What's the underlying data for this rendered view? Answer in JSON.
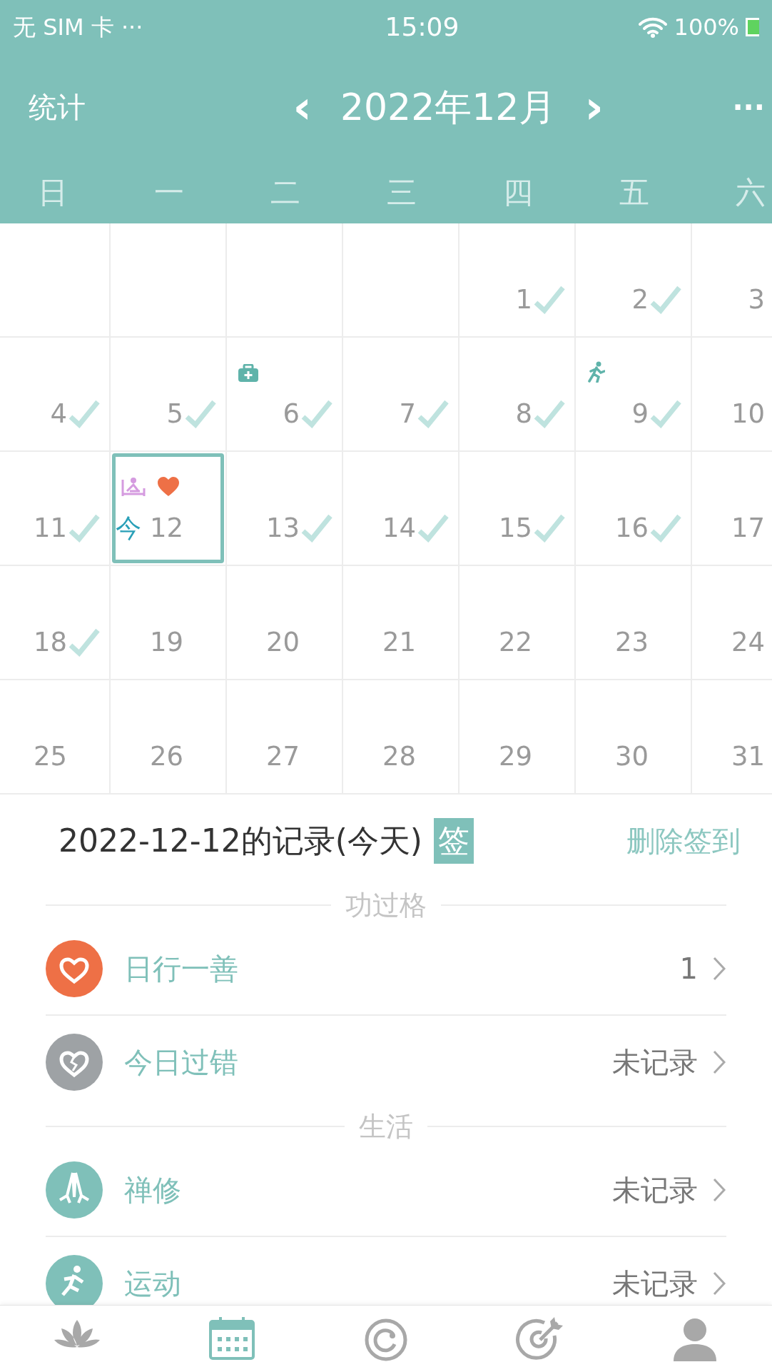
{
  "status_bar": {
    "carrier": "无 SIM 卡 ···",
    "time": "15:09",
    "battery": "100%"
  },
  "header": {
    "left": "统计",
    "prev": "‹",
    "title": "2022年12月",
    "next": "›",
    "more": "···"
  },
  "weekdays": [
    "日",
    "一",
    "二",
    "三",
    "四",
    "五",
    "六"
  ],
  "weeks": [
    [
      {
        "day": "1",
        "checked": true
      },
      {
        "day": "2",
        "checked": true
      },
      {
        "day": "3",
        "checked": false
      }
    ],
    [
      {
        "day": "4",
        "checked": true
      },
      {
        "day": "5",
        "checked": true
      },
      {
        "day": "6",
        "checked": true,
        "marks": [
          {
            "kind": "medical"
          }
        ]
      },
      {
        "day": "7",
        "checked": true
      },
      {
        "day": "8",
        "checked": true
      },
      {
        "day": "9",
        "checked": true,
        "marks": [
          {
            "kind": "exercise"
          }
        ]
      },
      {
        "day": "10",
        "checked": false
      }
    ],
    [
      {
        "day": "11",
        "checked": true
      },
      {
        "day": "12",
        "checked": false,
        "selected": true,
        "today_label": "今",
        "marks": [
          {
            "kind": "meditation"
          },
          {
            "kind": "good_deed"
          }
        ]
      },
      {
        "day": "13",
        "checked": true
      },
      {
        "day": "14",
        "checked": true
      },
      {
        "day": "15",
        "checked": true
      },
      {
        "day": "16",
        "checked": true
      },
      {
        "day": "17",
        "checked": false
      }
    ],
    [
      {
        "day": "18",
        "checked": true
      },
      {
        "day": "19",
        "checked": false
      },
      {
        "day": "20",
        "checked": false
      },
      {
        "day": "21",
        "checked": false
      },
      {
        "day": "22",
        "checked": false
      },
      {
        "day": "23",
        "checked": false
      },
      {
        "day": "24",
        "checked": false
      }
    ],
    [
      {
        "day": "25",
        "checked": false
      },
      {
        "day": "26",
        "checked": false
      },
      {
        "day": "27",
        "checked": false
      },
      {
        "day": "28",
        "checked": false
      },
      {
        "day": "29",
        "checked": false
      },
      {
        "day": "30",
        "checked": false
      },
      {
        "day": "31",
        "checked": false
      }
    ]
  ],
  "record": {
    "title": "2022-12-12的记录(今天)",
    "badge": "签",
    "action": "删除签到"
  },
  "sections": [
    {
      "title": "功过格",
      "items": [
        {
          "kind": "good_deed",
          "label": "日行一善",
          "value": "1"
        },
        {
          "kind": "mistake",
          "label": "今日过错",
          "value": "未记录"
        }
      ]
    },
    {
      "title": "生活",
      "items": [
        {
          "kind": "meditation",
          "label": "禅修",
          "value": "未记录"
        },
        {
          "kind": "exercise",
          "label": "运动",
          "value": "未记录"
        }
      ]
    }
  ],
  "nav": [
    {
      "kind": "lotus",
      "selected": false
    },
    {
      "kind": "calendar",
      "selected": true
    },
    {
      "kind": "ring",
      "selected": false
    },
    {
      "kind": "target",
      "selected": false
    },
    {
      "kind": "person",
      "selected": false
    }
  ]
}
